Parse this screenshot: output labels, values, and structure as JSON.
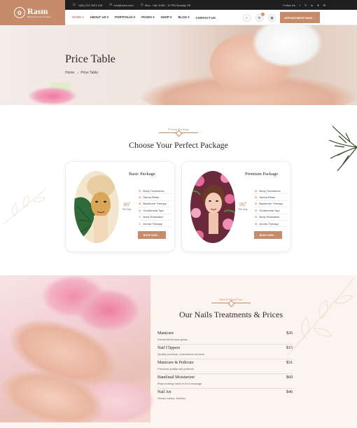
{
  "topbar": {
    "phone": "+(00) 214 2023 215",
    "email": "info@rasm.com",
    "hours": "Mon - Sat, 8 AM - 10 PM Sunday Off",
    "follow_label": "Follow Us",
    "social": [
      "f",
      "𝕏",
      "in",
      "♥",
      "✉"
    ]
  },
  "logo": {
    "name": "Rasm",
    "tagline": "Beauty Spa Care & Salon"
  },
  "nav": {
    "items": [
      "HOME",
      "ABOUT US",
      "PORTFOLIO",
      "PAGES",
      "SHOP",
      "BLOG",
      "CONTACT US"
    ],
    "cart_count": "0",
    "appointment_label": "APPOINTMENT NOW →"
  },
  "hero": {
    "title": "Price Table",
    "breadcrumb_home": "Home",
    "breadcrumb_sep": "→",
    "breadcrumb_current": "Price Table"
  },
  "packages": {
    "kicker": "Pricing Package",
    "title": "Choose Your Perfect Package",
    "cards": [
      {
        "name": "Basic Package",
        "price": "46",
        "currency": "$",
        "period": "Per Day",
        "features": [
          {
            "label": "Body Treatments",
            "included": true
          },
          {
            "label": "Sauna Relax",
            "included": true
          },
          {
            "label": "Backbone Therapy",
            "included": true
          },
          {
            "label": "Geothermal Spa",
            "included": true
          },
          {
            "label": "Body Relaxation",
            "included": false
          },
          {
            "label": "Aroma Therapy",
            "included": false
          }
        ],
        "button": "BOOK NOW →"
      },
      {
        "name": "Premium Package",
        "price": "96",
        "currency": "$",
        "period": "Per Day",
        "features": [
          {
            "label": "Body Treatments",
            "included": true
          },
          {
            "label": "Sauna Relax",
            "included": true
          },
          {
            "label": "Backbone Therapy",
            "included": true
          },
          {
            "label": "Geothermal Spa",
            "included": true
          },
          {
            "label": "Body Relaxation",
            "included": true
          },
          {
            "label": "Aroma Therapy",
            "included": true
          }
        ],
        "button": "BOOK NOW →"
      }
    ]
  },
  "nails": {
    "kicker": "Nail & Hand Care",
    "title": "Our Nails Treatments & Prices",
    "items": [
      {
        "name": "Manicure",
        "desc": "Elemental tempus gelas",
        "price": "$26"
      },
      {
        "name": "Nail Clippers",
        "desc": "Quality products, customized services",
        "price": "$15"
      },
      {
        "name": "Manicure & Pedicure",
        "desc": "Premium quality nail polishes",
        "price": "$31"
      },
      {
        "name": "Hand/nail Moisturizer",
        "desc": "Rejuvenating hand or foot massage",
        "price": "$60"
      },
      {
        "name": "Nail Art",
        "desc": "Vibrant colors, finishes",
        "price": "$46"
      }
    ]
  },
  "colors": {
    "accent": "#c58b6a",
    "dark": "#1f1f1f"
  }
}
